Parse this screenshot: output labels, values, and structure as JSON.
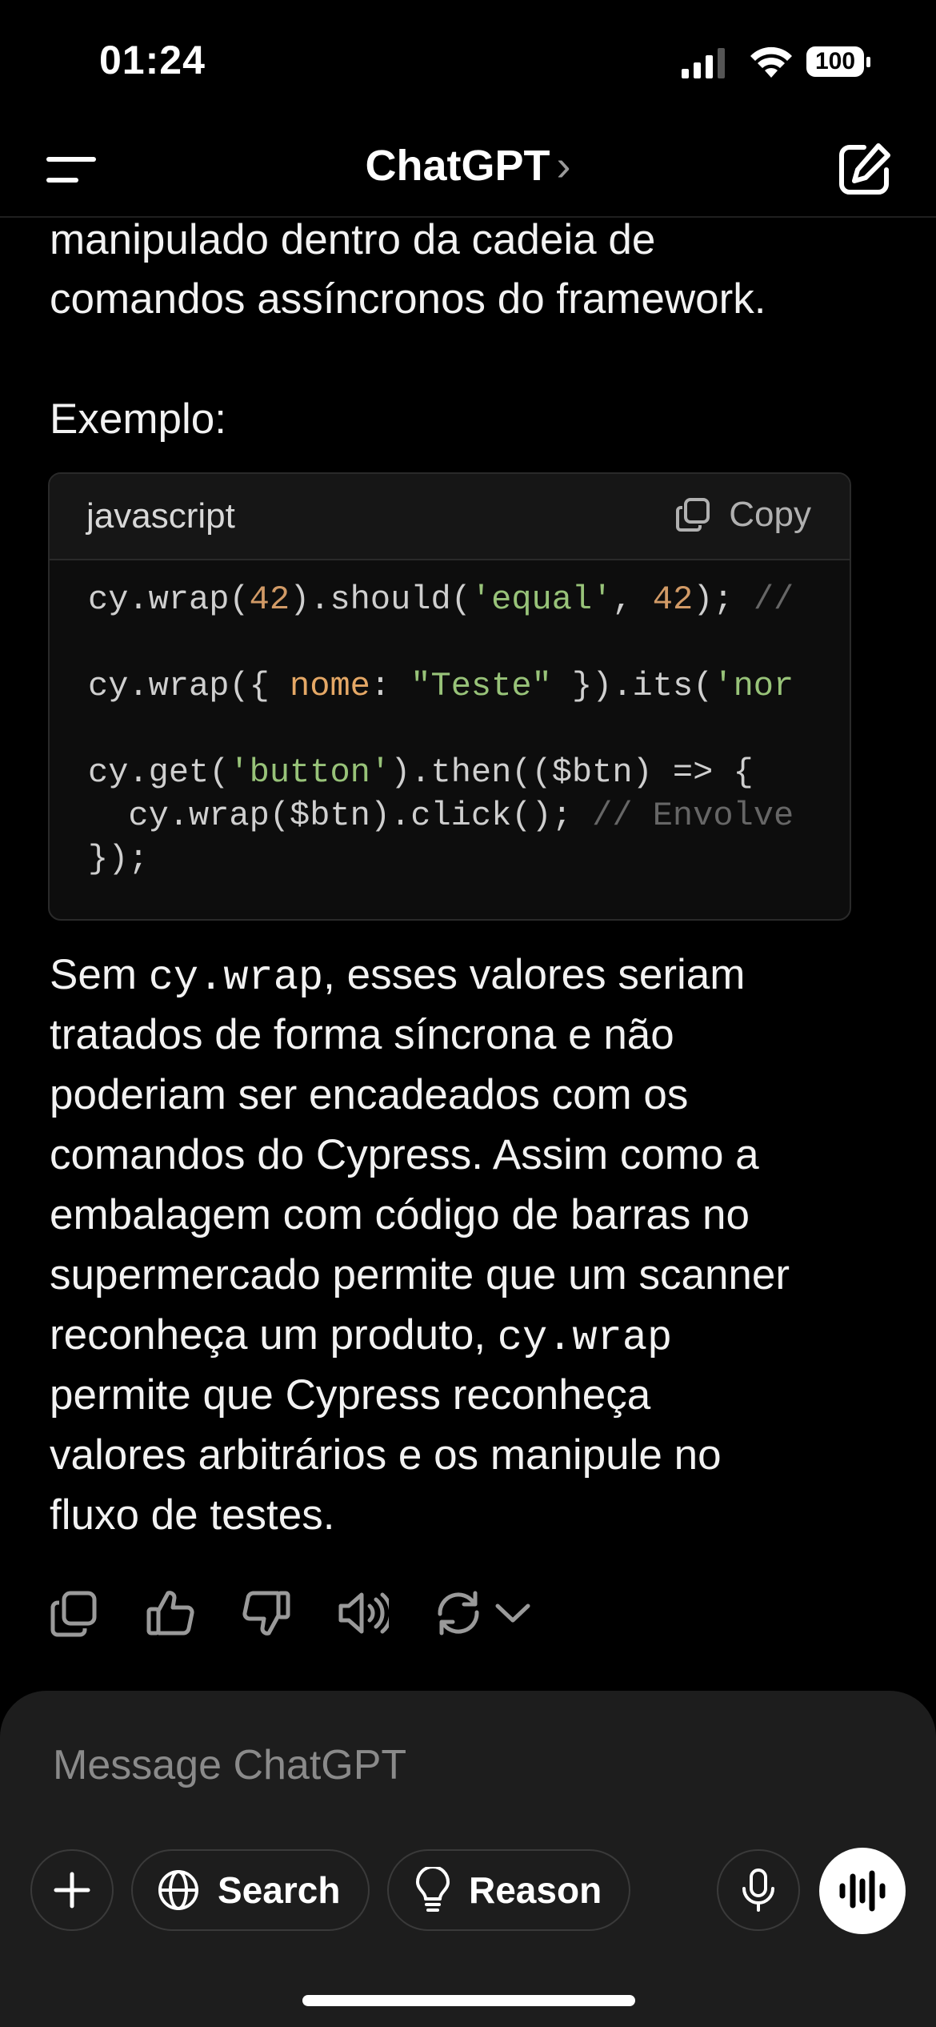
{
  "status_bar": {
    "time": "01:24",
    "battery": "100"
  },
  "nav": {
    "title": "ChatGPT",
    "chevron": "›"
  },
  "message": {
    "line_top_1": "manipulado dentro da cadeia de",
    "line_top_2": "comandos assíncronos do framework.",
    "example_label": "Exemplo:",
    "code_block": {
      "language": "javascript",
      "copy_label": "Copy",
      "lines": [
        "cy.wrap(42).should('equal', 42); //",
        "cy.wrap({ nome: \"Teste\" }).its('nor",
        "cy.get('button').then(($btn) => {",
        "  cy.wrap($btn).click(); // Envolve",
        "});"
      ]
    },
    "para": {
      "p1_a": "Sem ",
      "p1_code": "cy.wrap",
      "p1_b": ", esses valores seriam",
      "p2": "tratados de forma síncrona e não",
      "p3": "poderiam ser encadeados com os",
      "p4": "comandos do Cypress. Assim como a",
      "p5": "embalagem com código de barras no",
      "p6": "supermercado permite que um scanner",
      "p7_a": "reconheça um produto, ",
      "p7_code": "cy.wrap",
      "p8": "permite que Cypress reconheça",
      "p9": "valores arbitrários e os manipule no",
      "p10": "fluxo de testes."
    }
  },
  "actions": [
    "copy-icon",
    "thumbs-up-icon",
    "thumbs-down-icon",
    "read-aloud-icon",
    "regenerate-icon",
    "chevron-down-icon"
  ],
  "composer": {
    "placeholder": "Message ChatGPT",
    "search_label": "Search",
    "reason_label": "Reason"
  }
}
